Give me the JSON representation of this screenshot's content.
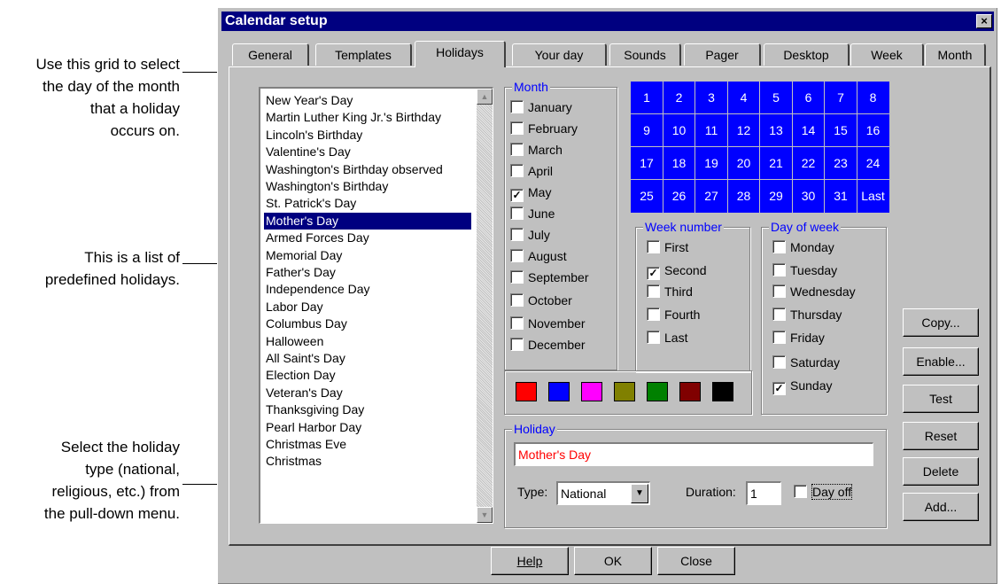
{
  "callouts": {
    "grid": [
      "Use this grid to select",
      "the day of the month",
      "that a holiday",
      "occurs on."
    ],
    "list": [
      "This is a list of",
      "predefined holidays."
    ],
    "type": [
      "Select the holiday",
      "type (national,",
      "religious, etc.) from",
      "the pull-down menu."
    ]
  },
  "window": {
    "title": "Calendar setup",
    "close_glyph": "×"
  },
  "tabs": [
    "General",
    "Templates",
    "Holidays",
    "Your day",
    "Sounds",
    "Pager",
    "Desktop",
    "Week",
    "Month"
  ],
  "holidays": [
    "New Year's Day",
    "Martin Luther King Jr.'s Birthday",
    "Lincoln's Birthday",
    "Valentine's Day",
    "Washington's Birthday observed",
    "Washington's Birthday",
    "St. Patrick's Day",
    "Mother's Day",
    "Armed Forces Day",
    "Memorial Day",
    "Father's Day",
    "Independence Day",
    "Labor Day",
    "Columbus Day",
    "Halloween",
    "All Saint's Day",
    "Election Day",
    "Veteran's Day",
    "Thanksgiving Day",
    "Pearl Harbor Day",
    "Christmas Eve",
    "Christmas"
  ],
  "selected_holiday": "Mother's Day",
  "month_group": {
    "label": "Month",
    "items": [
      {
        "label": "January",
        "checked": ""
      },
      {
        "label": "February",
        "checked": ""
      },
      {
        "label": "March",
        "checked": ""
      },
      {
        "label": "April",
        "checked": ""
      },
      {
        "label": "May",
        "checked": "✓"
      },
      {
        "label": "June",
        "checked": ""
      },
      {
        "label": "July",
        "checked": ""
      },
      {
        "label": "August",
        "checked": ""
      },
      {
        "label": "September",
        "checked": ""
      },
      {
        "label": "October",
        "checked": ""
      },
      {
        "label": "November",
        "checked": ""
      },
      {
        "label": "December",
        "checked": ""
      }
    ]
  },
  "day_grid": [
    "1",
    "2",
    "3",
    "4",
    "5",
    "6",
    "7",
    "8",
    "9",
    "10",
    "11",
    "12",
    "13",
    "14",
    "15",
    "16",
    "17",
    "18",
    "19",
    "20",
    "21",
    "22",
    "23",
    "24",
    "25",
    "26",
    "27",
    "28",
    "29",
    "30",
    "31",
    "Last"
  ],
  "week_group": {
    "label": "Week number",
    "items": [
      {
        "label": "First",
        "checked": ""
      },
      {
        "label": "Second",
        "checked": "✓"
      },
      {
        "label": "Third",
        "checked": ""
      },
      {
        "label": "Fourth",
        "checked": ""
      },
      {
        "label": "Last",
        "checked": ""
      }
    ]
  },
  "dow_group": {
    "label": "Day of week",
    "items": [
      {
        "label": "Monday",
        "checked": ""
      },
      {
        "label": "Tuesday",
        "checked": ""
      },
      {
        "label": "Wednesday",
        "checked": ""
      },
      {
        "label": "Thursday",
        "checked": ""
      },
      {
        "label": "Friday",
        "checked": ""
      },
      {
        "label": "Saturday",
        "checked": ""
      },
      {
        "label": "Sunday",
        "checked": "✓"
      }
    ]
  },
  "colors": [
    "#ff0000",
    "#0000ff",
    "#ff00ff",
    "#808000",
    "#008000",
    "#800000",
    "#000000"
  ],
  "holiday_group": {
    "label": "Holiday",
    "name": "Mother's Day",
    "type_label": "Type:",
    "type_value": "National",
    "duration_label": "Duration:",
    "duration_value": "1",
    "dayoff_label": "Day off",
    "dayoff_checked": ""
  },
  "side_buttons": [
    "Copy...",
    "Enable...",
    "Test",
    "Reset",
    "Delete",
    "Add..."
  ],
  "bottom_buttons": [
    "Help",
    "OK",
    "Close"
  ]
}
